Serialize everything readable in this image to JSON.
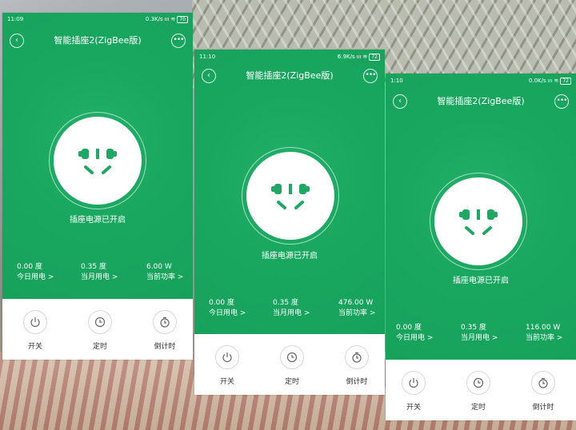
{
  "screens": [
    {
      "status_time": "11:09",
      "net_speed": "0.3K/s",
      "battery": "70",
      "title": "智能插座2(ZigBee版)",
      "status_text": "插座电源已开启",
      "stats": [
        {
          "value": "0.00 度",
          "label": "今日用电 >"
        },
        {
          "value": "0.35 度",
          "label": "当月用电 >"
        },
        {
          "value": "6.00 W",
          "label": "当前功率 >"
        }
      ]
    },
    {
      "status_time": "11:10",
      "net_speed": "6.9K/s",
      "battery": "72",
      "title": "智能插座2(ZigBee版)",
      "status_text": "插座电源已开启",
      "stats": [
        {
          "value": "0.00 度",
          "label": "今日用电 >"
        },
        {
          "value": "0.35 度",
          "label": "当月用电 >"
        },
        {
          "value": "476.00 W",
          "label": "当前功率 >"
        }
      ]
    },
    {
      "status_time": "1:10",
      "net_speed": "0.0K/s",
      "battery": "72",
      "title": "智能插座2(ZigBee版)",
      "status_text": "插座电源已开启",
      "stats": [
        {
          "value": "0.00 度",
          "label": "今日用电 >"
        },
        {
          "value": "0.35 度",
          "label": "当月用电 >"
        },
        {
          "value": "116.00 W",
          "label": "当前功率 >"
        }
      ]
    }
  ],
  "controls": {
    "power": "开关",
    "timer": "定时",
    "countdown": "倒计时"
  },
  "icons": {
    "back": "chevron-left-icon",
    "more": "more-dots-icon",
    "power": "power-icon",
    "timer": "clock-icon",
    "countdown": "stopwatch-icon"
  },
  "colors": {
    "accent_green": "#19a75f",
    "socket_green": "#1fa864"
  }
}
